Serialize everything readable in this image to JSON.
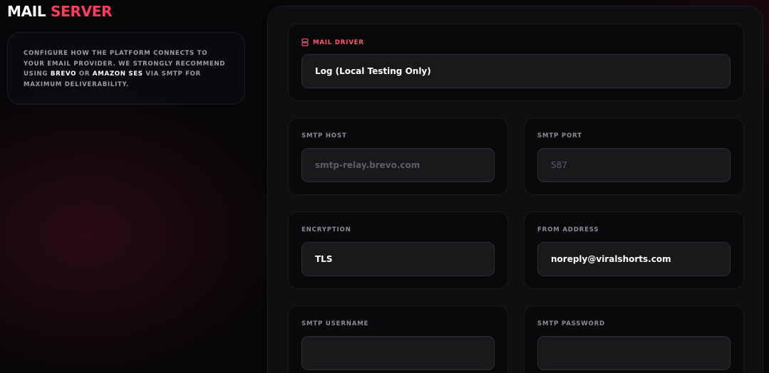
{
  "header": {
    "title_part1": "MAIL",
    "title_part2": "SERVER"
  },
  "info": {
    "text_before": "CONFIGURE HOW THE PLATFORM CONNECTS TO YOUR EMAIL PROVIDER. WE STRONGLY RECOMMEND USING ",
    "highlight1": "BREVO",
    "text_mid": " OR ",
    "highlight2": "AMAZON SES",
    "text_after": " VIA SMTP FOR MAXIMUM DELIVERABILITY."
  },
  "mail_driver": {
    "label": "MAIL DRIVER",
    "icon": "database-icon",
    "value": "Log (Local Testing Only)"
  },
  "smtp_host": {
    "label": "SMTP HOST",
    "value": "",
    "placeholder": "smtp-relay.brevo.com"
  },
  "smtp_port": {
    "label": "SMTP PORT",
    "value": "",
    "placeholder": "587"
  },
  "encryption": {
    "label": "ENCRYPTION",
    "value": "TLS"
  },
  "from_address": {
    "label": "FROM ADDRESS",
    "value": "noreply@viralshorts.com"
  },
  "smtp_username": {
    "label": "SMTP USERNAME",
    "value": ""
  },
  "smtp_password": {
    "label": "SMTP PASSWORD",
    "value": ""
  },
  "colors": {
    "accent": "#ff3d5a",
    "background": "#060608",
    "card": "#09090b",
    "field": "#19191c"
  }
}
